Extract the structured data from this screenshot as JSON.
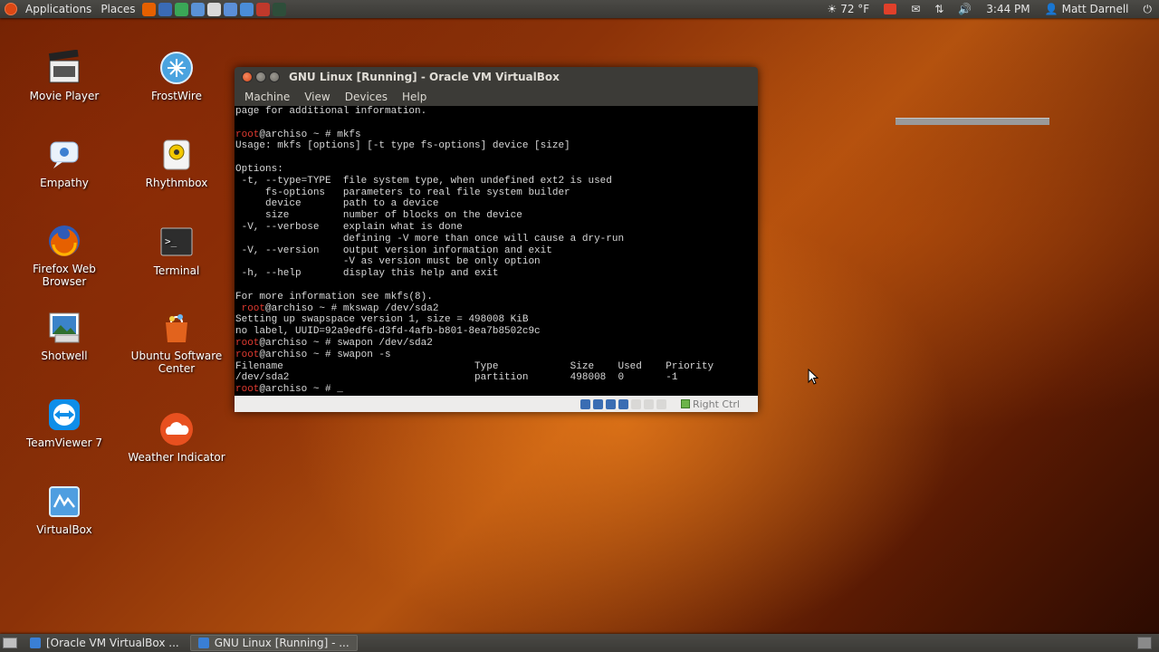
{
  "top_panel": {
    "menus": [
      "Applications",
      "Places"
    ],
    "launchers": [
      {
        "icon": "firefox-icon",
        "color": "#e66000"
      },
      {
        "icon": "thunderbird-icon",
        "color": "#3a6bb5"
      },
      {
        "icon": "chrome-icon",
        "color": "#3aa757"
      },
      {
        "icon": "vpn-icon",
        "color": "#5a92d6"
      },
      {
        "icon": "pen-icon",
        "color": "#d9d9d9"
      },
      {
        "icon": "globe-icon",
        "color": "#5b8fd8"
      },
      {
        "icon": "remote-desktop-icon",
        "color": "#4a8dd8"
      },
      {
        "icon": "monitor-icon",
        "color": "#c0392b"
      },
      {
        "icon": "system-monitor-icon",
        "color": "#2e4e3a"
      }
    ],
    "weather": "72 °F",
    "time": "3:44 PM",
    "user": "Matt Darnell"
  },
  "desktop_icons": [
    {
      "label": "Movie Player",
      "icon": "movie-player-icon"
    },
    {
      "label": "FrostWire",
      "icon": "frostwire-icon"
    },
    {
      "label": "Empathy",
      "icon": "empathy-icon"
    },
    {
      "label": "Rhythmbox",
      "icon": "rhythmbox-icon"
    },
    {
      "label": "Firefox Web Browser",
      "icon": "firefox-icon"
    },
    {
      "label": "Terminal",
      "icon": "terminal-icon"
    },
    {
      "label": "Shotwell",
      "icon": "shotwell-icon"
    },
    {
      "label": "Ubuntu Software Center",
      "icon": "software-center-icon"
    },
    {
      "label": "TeamViewer 7",
      "icon": "teamviewer-icon"
    },
    {
      "label": "Weather Indicator",
      "icon": "weather-indicator-icon"
    },
    {
      "label": "VirtualBox",
      "icon": "virtualbox-icon"
    }
  ],
  "vbox_window": {
    "title": "GNU Linux [Running] - Oracle VM VirtualBox",
    "menus": [
      "Machine",
      "View",
      "Devices",
      "Help"
    ],
    "host_key": "Right Ctrl"
  },
  "terminal": {
    "lines": [
      {
        "text": "page for additional information."
      },
      {
        "text": ""
      },
      {
        "prompt": "root",
        "text": "@archiso ~ # mkfs"
      },
      {
        "text": "Usage: mkfs [options] [-t type fs-options] device [size]"
      },
      {
        "text": ""
      },
      {
        "text": "Options:"
      },
      {
        "text": " -t, --type=TYPE  file system type, when undefined ext2 is used"
      },
      {
        "text": "     fs-options   parameters to real file system builder"
      },
      {
        "text": "     device       path to a device"
      },
      {
        "text": "     size         number of blocks on the device"
      },
      {
        "text": " -V, --verbose    explain what is done"
      },
      {
        "text": "                  defining -V more than once will cause a dry-run"
      },
      {
        "text": " -V, --version    output version information and exit"
      },
      {
        "text": "                  -V as version must be only option"
      },
      {
        "text": " -h, --help       display this help and exit"
      },
      {
        "text": ""
      },
      {
        "text": "For more information see mkfs(8)."
      },
      {
        "prompt": " root",
        "text": "@archiso ~ # mkswap /dev/sda2"
      },
      {
        "text": "Setting up swapspace version 1, size = 498008 KiB"
      },
      {
        "text": "no label, UUID=92a9edf6-d3fd-4afb-b801-8ea7b8502c9c"
      },
      {
        "prompt": "root",
        "text": "@archiso ~ # swapon /dev/sda2"
      },
      {
        "prompt": "root",
        "text": "@archiso ~ # swapon -s"
      },
      {
        "text": "Filename                                Type            Size    Used    Priority"
      },
      {
        "text": "/dev/sda2                               partition       498008  0       -1"
      },
      {
        "prompt": "root",
        "text": "@archiso ~ # _"
      }
    ]
  },
  "taskbar": {
    "items": [
      {
        "label": "[Oracle VM VirtualBox ...",
        "active": false
      },
      {
        "label": "GNU Linux [Running] - ...",
        "active": true
      }
    ]
  }
}
